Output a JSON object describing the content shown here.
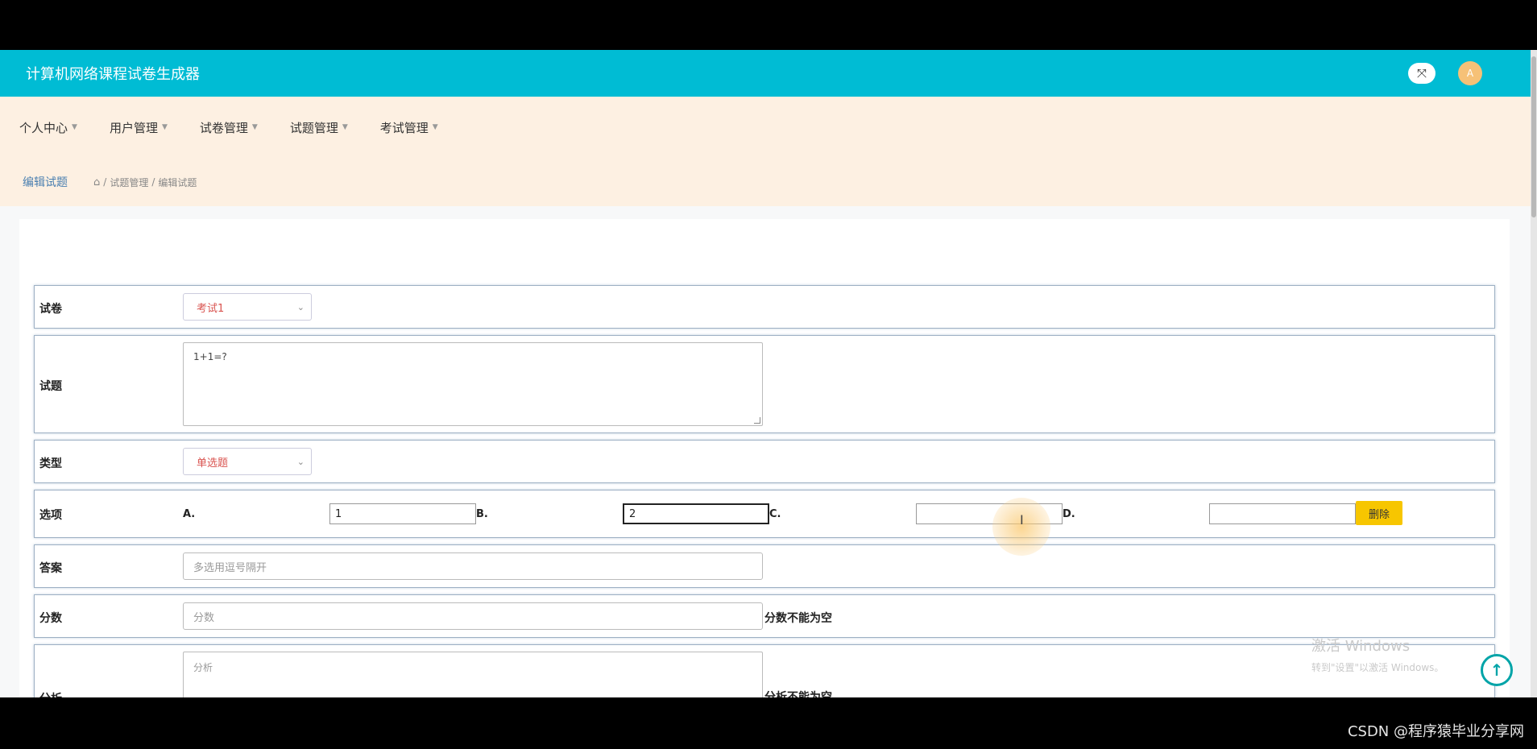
{
  "header": {
    "title": "计算机网络课程试卷生成器",
    "fullscreen_icon": "expand-arrows-icon",
    "avatar_text": "A",
    "brand_color": "#00bcd4"
  },
  "menu": {
    "items": [
      {
        "label": "个人中心"
      },
      {
        "label": "用户管理"
      },
      {
        "label": "试卷管理"
      },
      {
        "label": "试题管理"
      },
      {
        "label": "考试管理"
      }
    ]
  },
  "breadcrumb": {
    "title": "编辑试题",
    "path": [
      "试题管理",
      "编辑试题"
    ],
    "separator": "/"
  },
  "form": {
    "paper": {
      "label": "试卷",
      "value": "考试1"
    },
    "question": {
      "label": "试题",
      "value": "1+1=?"
    },
    "type": {
      "label": "类型",
      "value": "单选题"
    },
    "options": {
      "label": "选项",
      "items": [
        {
          "key": "A.",
          "value": "1"
        },
        {
          "key": "B.",
          "value": "2"
        },
        {
          "key": "C.",
          "value": ""
        },
        {
          "key": "D.",
          "value": ""
        }
      ],
      "delete_label": "删除"
    },
    "answer": {
      "label": "答案",
      "placeholder": "多选用逗号隔开"
    },
    "score": {
      "label": "分数",
      "placeholder": "分数",
      "error": "分数不能为空"
    },
    "analysis": {
      "label": "分析",
      "placeholder": "分析",
      "error": "分析不能为空"
    }
  },
  "watermark": {
    "line1": "激活 Windows",
    "line2": "转到\"设置\"以激活 Windows。"
  },
  "back_to_top_icon": "arrow-up-circle-icon",
  "csdn_credit": "CSDN @程序猿毕业分享网"
}
